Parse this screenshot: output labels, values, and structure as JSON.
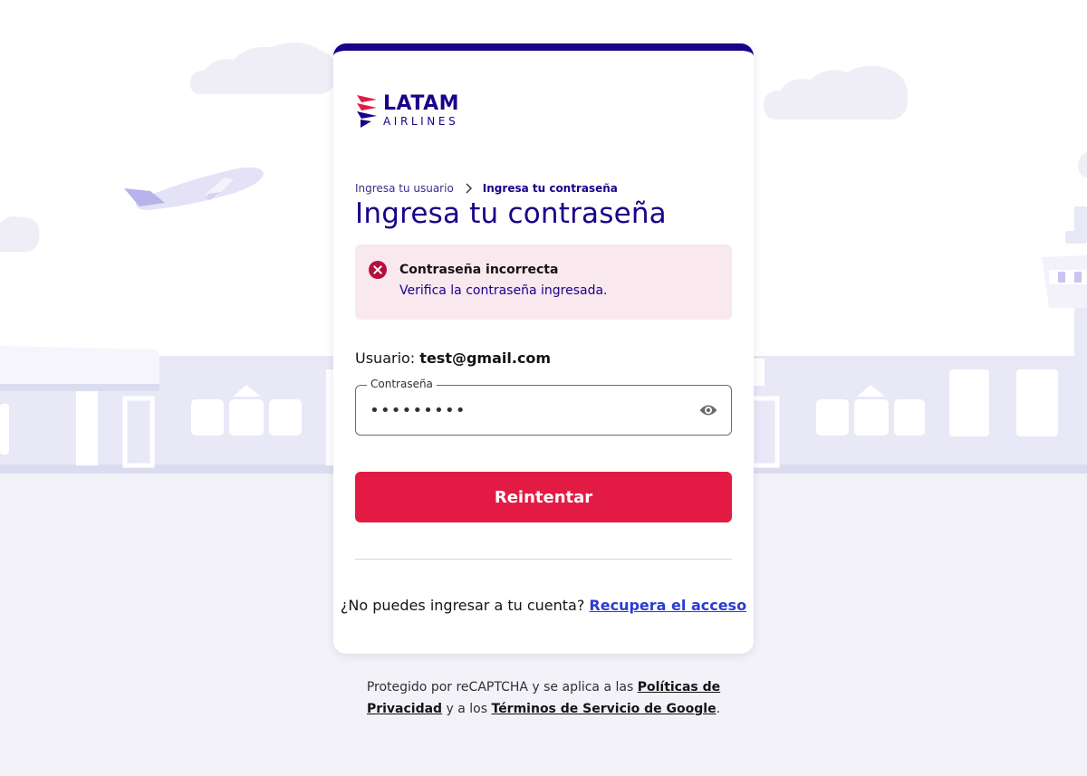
{
  "brand": {
    "name": "LATAM",
    "sub": "AIRLINES",
    "colors": {
      "navy": "#1b0088",
      "red": "#e31b44",
      "link": "#2a3bd4"
    }
  },
  "breadcrumb": {
    "step1": "Ingresa tu usuario",
    "step2": "Ingresa tu contraseña"
  },
  "title": "Ingresa tu contraseña",
  "alert": {
    "icon": "error-circle-icon",
    "title": "Contraseña incorrecta",
    "message": "Verifica la contraseña ingresada."
  },
  "user": {
    "label": "Usuario:",
    "value": "test@gmail.com"
  },
  "password_field": {
    "label": "Contraseña",
    "value": "•••••••••",
    "toggle_icon": "eye-icon"
  },
  "retry_button": "Reintentar",
  "recover": {
    "text": "¿No puedes ingresar a tu cuenta?",
    "link": "Recupera el acceso"
  },
  "footer": {
    "text1": "Protegido por reCAPTCHA y se aplica a las",
    "privacy_link": "Políticas de Privacidad",
    "text2": "y a los",
    "terms_link": "Términos de Servicio de Google",
    "period": "."
  }
}
